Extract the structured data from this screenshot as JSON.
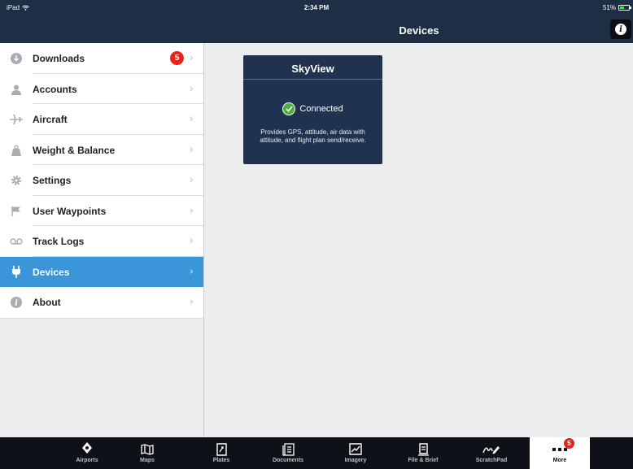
{
  "status_bar": {
    "device": "iPad",
    "time": "2:34 PM",
    "battery": "51%",
    "battery_level": 0.51
  },
  "navbar": {
    "title": "Devices",
    "info_icon": "info-icon"
  },
  "sidebar": {
    "items": [
      {
        "label": "Downloads",
        "icon": "download-icon",
        "badge": "5"
      },
      {
        "label": "Accounts",
        "icon": "person-icon"
      },
      {
        "label": "Aircraft",
        "icon": "airplane-icon"
      },
      {
        "label": "Weight & Balance",
        "icon": "weight-icon"
      },
      {
        "label": "Settings",
        "icon": "gear-icon"
      },
      {
        "label": "User Waypoints",
        "icon": "flag-icon"
      },
      {
        "label": "Track Logs",
        "icon": "tracklog-icon"
      },
      {
        "label": "Devices",
        "icon": "plug-icon",
        "selected": true
      },
      {
        "label": "About",
        "icon": "info-icon"
      }
    ]
  },
  "device_card": {
    "title": "SkyView",
    "status": "Connected",
    "description": "Provides GPS, attitude, air data with attitude, and flight plan send/receive."
  },
  "tabbar": {
    "tabs": [
      {
        "label": "Airports",
        "icon": "airport-icon"
      },
      {
        "label": "Maps",
        "icon": "map-icon"
      },
      {
        "label": "Plates",
        "icon": "plates-icon"
      },
      {
        "label": "Documents",
        "icon": "documents-icon"
      },
      {
        "label": "Imagery",
        "icon": "imagery-icon"
      },
      {
        "label": "File & Brief",
        "icon": "file-brief-icon"
      },
      {
        "label": "ScratchPad",
        "icon": "scratchpad-icon"
      },
      {
        "label": "More",
        "icon": "more-icon",
        "badge": "5",
        "selected": true
      }
    ]
  },
  "colors": {
    "navbar": "#1d2e45",
    "selected_row": "#3a95d9",
    "card": "#1f3350",
    "badge": "#e8231c",
    "connected": "#4caf3b"
  }
}
